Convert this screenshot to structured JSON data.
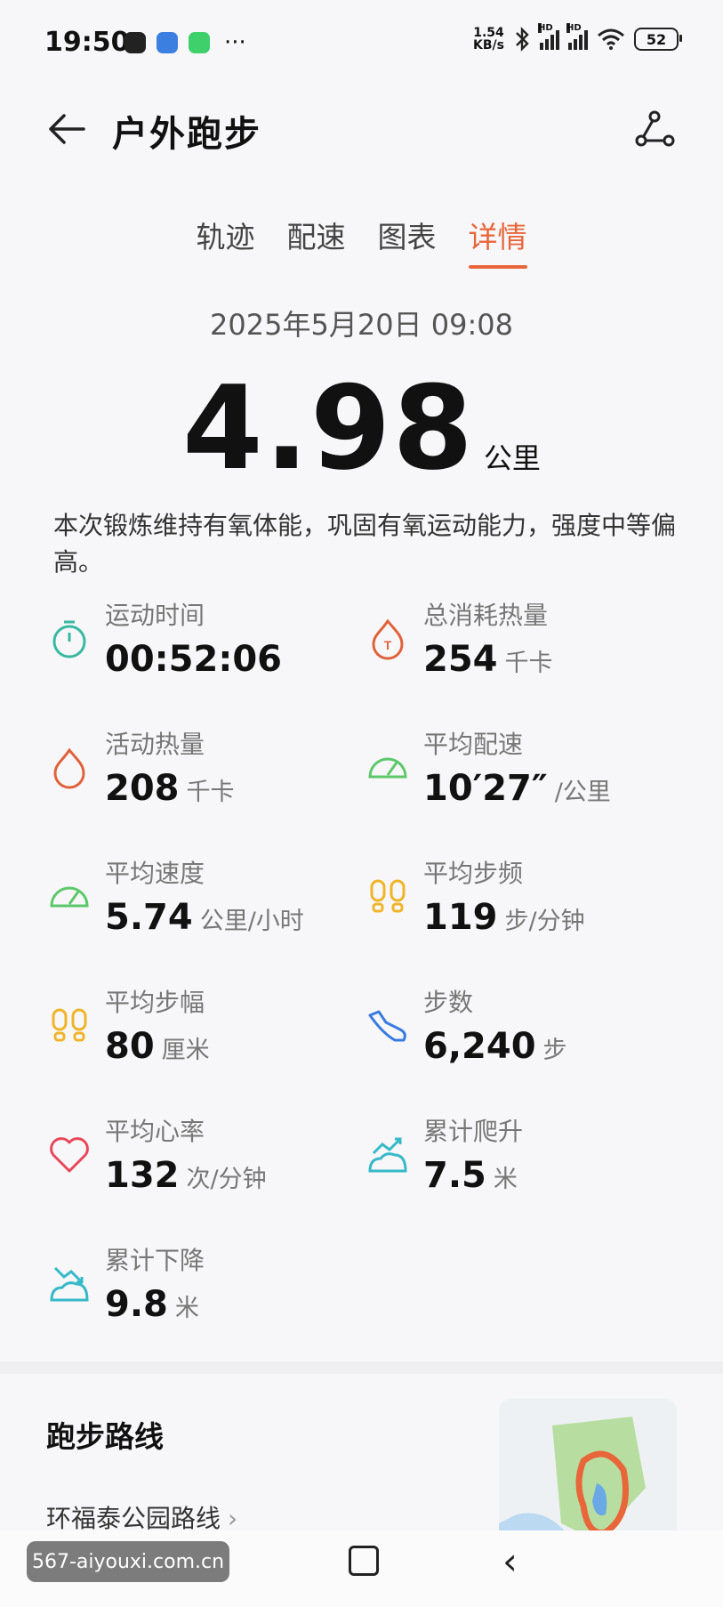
{
  "status_bar": {
    "time": "19:50",
    "net_speed_value": "1.54",
    "net_speed_unit": "KB/s",
    "hd_label": "HD",
    "battery": "52"
  },
  "header": {
    "title": "户外跑步"
  },
  "tabs": [
    {
      "label": "轨迹",
      "active": false
    },
    {
      "label": "配速",
      "active": false
    },
    {
      "label": "图表",
      "active": false
    },
    {
      "label": "详情",
      "active": true
    }
  ],
  "workout": {
    "datetime": "2025年5月20日 09:08",
    "distance": "4.98",
    "distance_unit": "公里",
    "summary": "本次锻炼维持有氧体能，巩固有氧运动能力，强度中等偏高。"
  },
  "stats": [
    {
      "label": "运动时间",
      "value": "00:52:06",
      "unit": "",
      "icon": "stopwatch-icon",
      "color": "#39b8a0"
    },
    {
      "label": "总消耗热量",
      "value": "254",
      "unit": "千卡",
      "icon": "total-calorie-icon",
      "color": "#e0623a"
    },
    {
      "label": "活动热量",
      "value": "208",
      "unit": "千卡",
      "icon": "flame-icon",
      "color": "#e0623a"
    },
    {
      "label": "平均配速",
      "value": "10′27″",
      "unit": "/公里",
      "icon": "speedometer-icon",
      "color": "#5dc86a"
    },
    {
      "label": "平均速度",
      "value": "5.74",
      "unit": "公里/小时",
      "icon": "speedometer-icon",
      "color": "#5dc86a"
    },
    {
      "label": "平均步频",
      "value": "119",
      "unit": "步/分钟",
      "icon": "footprints-icon",
      "color": "#f0b429"
    },
    {
      "label": "平均步幅",
      "value": "80",
      "unit": "厘米",
      "icon": "footprints-icon",
      "color": "#f0b429"
    },
    {
      "label": "步数",
      "value": "6,240",
      "unit": "步",
      "icon": "shoe-icon",
      "color": "#3a7be0"
    },
    {
      "label": "平均心率",
      "value": "132",
      "unit": "次/分钟",
      "icon": "heart-icon",
      "color": "#e8475a"
    },
    {
      "label": "累计爬升",
      "value": "7.5",
      "unit": "米",
      "icon": "climb-icon",
      "color": "#37b9c7"
    },
    {
      "label": "累计下降",
      "value": "9.8",
      "unit": "米",
      "icon": "descent-icon",
      "color": "#37b9c7"
    }
  ],
  "route": {
    "title": "跑步路线",
    "name": "环福泰公园路线"
  },
  "watermark": "567-aiyouxi.com.cn",
  "accent_color": "#e8663a"
}
